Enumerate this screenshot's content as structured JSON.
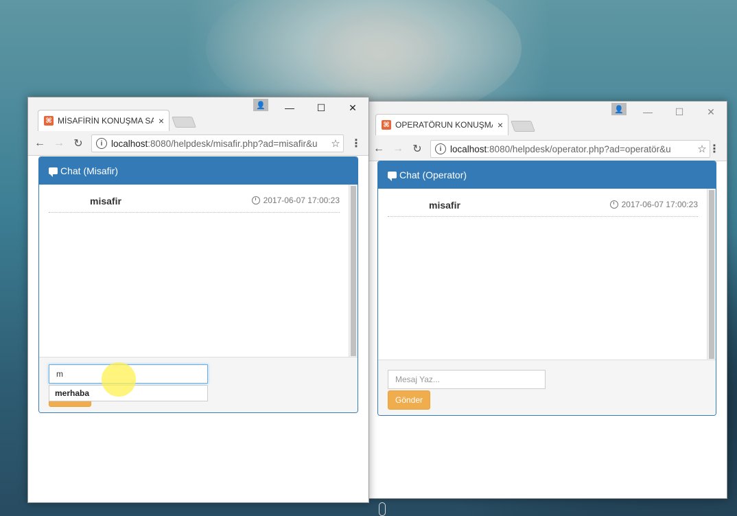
{
  "left_window": {
    "tab_title": "MİSAFİRİN KONUŞMA SA",
    "tab_close": "×",
    "controls": {
      "minimize": "—",
      "maximize": "☐",
      "close": "✕",
      "profile": "👤"
    },
    "nav": {
      "back": "←",
      "forward": "→",
      "reload": "↻",
      "menu": "⋮",
      "star": "☆",
      "info": "i"
    },
    "url_host": "localhost",
    "url_rest": ":8080/helpdesk/misafir.php?ad=misafir&u",
    "panel_title": "Chat (Misafir)",
    "messages": [
      {
        "user": "misafir",
        "time": "2017-06-07 17:00:23"
      }
    ],
    "input_value": "m",
    "autocomplete_option": "merhaba"
  },
  "right_window": {
    "tab_title": "OPERATÖRUN KONUŞMA",
    "tab_close": "×",
    "controls": {
      "minimize": "—",
      "maximize": "☐",
      "close": "✕",
      "profile": "👤"
    },
    "nav": {
      "back": "←",
      "forward": "→",
      "reload": "↻",
      "menu": "⋮",
      "star": "☆",
      "info": "i"
    },
    "url_host": "localhost",
    "url_rest": ":8080/helpdesk/operator.php?ad=operatör&u",
    "panel_title": "Chat (Operator)",
    "messages": [
      {
        "user": "misafir",
        "time": "2017-06-07 17:00:23"
      }
    ],
    "input_placeholder": "Mesaj Yaz...",
    "send_label": "Gönder"
  },
  "colors": {
    "panel_blue": "#337ab7",
    "button_orange": "#f0ad4e",
    "favicon": "#e8673a"
  }
}
